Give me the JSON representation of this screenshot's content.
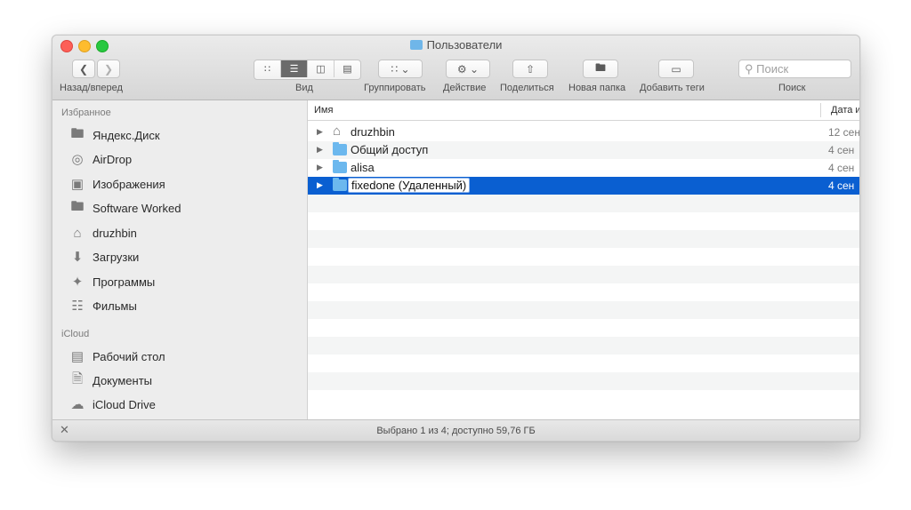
{
  "window": {
    "title": "Пользователи"
  },
  "toolbar": {
    "nav_label": "Назад/вперед",
    "view_label": "Вид",
    "group_label": "Группировать",
    "action_label": "Действие",
    "share_label": "Поделиться",
    "new_folder_label": "Новая папка",
    "tags_label": "Добавить теги",
    "search_label": "Поиск",
    "search_placeholder": "Поиск"
  },
  "sidebar": {
    "favorites_header": "Избранное",
    "favorites": [
      {
        "label": "Яндекс.Диск",
        "icon": "folder-icon"
      },
      {
        "label": "AirDrop",
        "icon": "airdrop-icon"
      },
      {
        "label": "Изображения",
        "icon": "camera-icon"
      },
      {
        "label": "Software Worked",
        "icon": "folder-icon"
      },
      {
        "label": "druzhbin",
        "icon": "home-icon"
      },
      {
        "label": "Загрузки",
        "icon": "download-icon"
      },
      {
        "label": "Программы",
        "icon": "applications-icon"
      },
      {
        "label": "Фильмы",
        "icon": "film-icon"
      }
    ],
    "icloud_header": "iCloud",
    "icloud": [
      {
        "label": "Рабочий стол",
        "icon": "desktop-icon"
      },
      {
        "label": "Документы",
        "icon": "documents-icon"
      },
      {
        "label": "iCloud Drive",
        "icon": "cloud-icon"
      }
    ]
  },
  "list": {
    "col_name": "Имя",
    "col_date": "Дата и",
    "rows": [
      {
        "name": "druzhbin",
        "date": "12 сен",
        "icon": "home-icon"
      },
      {
        "name": "Общий доступ",
        "date": "4 сен",
        "icon": "folder-icon"
      },
      {
        "name": "alisa",
        "date": "4 сен",
        "icon": "folder-icon"
      },
      {
        "name": "fixedone (Удаленный)",
        "date": "4 сен",
        "icon": "folder-icon",
        "selected": true
      }
    ]
  },
  "status": {
    "text": "Выбрано 1 из 4; доступно 59,76 ГБ"
  },
  "colors": {
    "selection": "#0a5fd1",
    "folder": "#6cb8ee"
  }
}
